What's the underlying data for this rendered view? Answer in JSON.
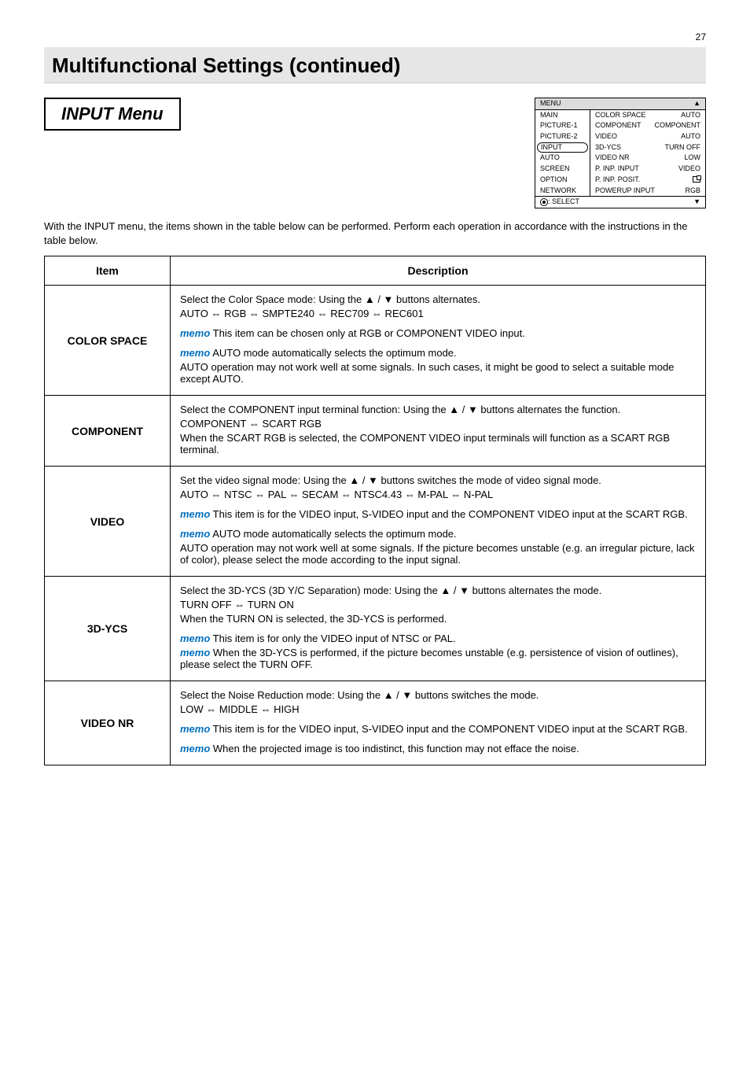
{
  "page_number": "27",
  "title": "Multifunctional Settings (continued)",
  "section_title": "INPUT Menu",
  "osd": {
    "header_left": "MENU",
    "left_items": [
      "MAIN",
      "PICTURE-1",
      "PICTURE-2",
      "INPUT",
      "AUTO",
      "SCREEN",
      "OPTION",
      "NETWORK"
    ],
    "selected_index": 3,
    "right_rows": [
      {
        "l": "COLOR SPACE",
        "r": "AUTO"
      },
      {
        "l": "COMPONENT",
        "r": "COMPONENT"
      },
      {
        "l": "VIDEO",
        "r": "AUTO"
      },
      {
        "l": "3D-YCS",
        "r": "TURN OFF"
      },
      {
        "l": "VIDEO NR",
        "r": "LOW"
      },
      {
        "l": "P. INP.  INPUT",
        "r": "VIDEO"
      },
      {
        "l": "P. INP.  POSIT.",
        "r": ""
      },
      {
        "l": "POWERUP INPUT",
        "r": "RGB"
      }
    ],
    "footer_left": ": SELECT"
  },
  "intro": "With the INPUT menu, the items shown in the table below can be performed. Perform each operation in accordance with the instructions in the table below.",
  "headers": {
    "item": "Item",
    "desc": "Description"
  },
  "rows": {
    "color_space": {
      "name": "COLOR SPACE",
      "line1": "Select the Color Space mode: Using the ▲ / ▼ buttons alternates.",
      "line2": "AUTO ⇔ RGB ⇔ SMPTE240 ⇔ REC709 ⇔ REC601",
      "memo1_label": "memo",
      "memo1": " This item can be chosen only at RGB or COMPONENT VIDEO input.",
      "memo2_label": "memo",
      "memo2": " AUTO mode automatically selects the optimum mode.",
      "memo3": "AUTO operation may not work well at some signals. In such cases, it might be good to select a suitable mode except AUTO."
    },
    "component": {
      "name": "COMPONENT",
      "line1": "Select the COMPONENT input terminal function: Using the ▲ / ▼ buttons alternates the function.",
      "line2": "COMPONENT ⇔ SCART RGB",
      "line3": "When the SCART RGB is selected, the COMPONENT VIDEO input terminals will function as a SCART RGB terminal."
    },
    "video": {
      "name": "VIDEO",
      "line1": "Set the video signal mode: Using the ▲ / ▼ buttons switches the mode of video signal mode.",
      "line2": "AUTO ⇔ NTSC ⇔ PAL ⇔ SECAM ⇔ NTSC4.43 ⇔ M-PAL ⇔ N-PAL",
      "memo1_label": "memo",
      "memo1": " This item is for the VIDEO input, S-VIDEO input and the COMPONENT VIDEO input at the SCART RGB.",
      "memo2_label": "memo",
      "memo2": " AUTO mode automatically selects the optimum mode.",
      "memo3": "AUTO operation may not work well at some signals. If the picture becomes unstable (e.g. an irregular picture, lack of color), please select the mode according to the input signal."
    },
    "ycs": {
      "name": "3D-YCS",
      "line1": "Select the 3D-YCS (3D Y/C Separation) mode: Using the ▲ / ▼ buttons alternates the mode.",
      "line2": "TURN OFF ⇔ TURN ON",
      "line3": "When the TURN ON is selected, the 3D-YCS is performed.",
      "memo1_label": "memo",
      "memo1": " This item is for only the VIDEO input of NTSC or PAL.",
      "memo2_label": "memo",
      "memo2": " When the 3D-YCS is performed, if the picture becomes unstable (e.g. persistence of vision of outlines), please select the TURN OFF."
    },
    "videonr": {
      "name": "VIDEO NR",
      "line1": "Select the Noise Reduction mode: Using the ▲ / ▼ buttons switches the mode.",
      "line2": "LOW ⇔ MIDDLE ⇔ HIGH",
      "memo1_label": "memo",
      "memo1": " This item is for the VIDEO input, S-VIDEO input and the COMPONENT VIDEO input at the SCART RGB.",
      "memo2_label": "memo",
      "memo2": " When the projected image is too indistinct, this function may not efface the noise."
    }
  }
}
